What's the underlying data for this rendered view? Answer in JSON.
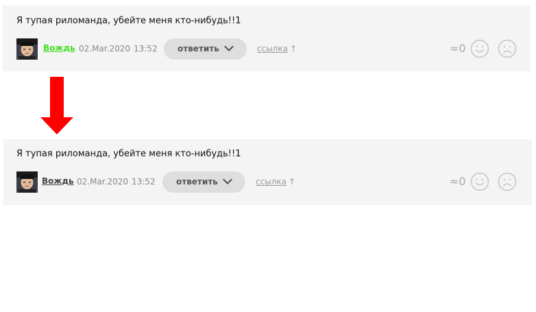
{
  "comments": [
    {
      "text": "Я тупая риломанда, убейте меня кто-нибудь!!1",
      "author": "Вождь",
      "author_color": "#44dd22",
      "date": "02.Mar.2020",
      "time": "13:52",
      "reply_label": "ответить",
      "link_label": "ссылка",
      "link_arrow": "↑",
      "score": "≈0",
      "icons": {
        "like": "smile-icon",
        "dislike": "frown-icon",
        "reply": "chevron-down-icon"
      }
    },
    {
      "text": "Я тупая риломанда, убейте меня кто-нибудь!!1",
      "author": "Вождь",
      "author_color": "#444444",
      "date": "02.Mar.2020",
      "time": "13:52",
      "reply_label": "ответить",
      "link_label": "ссылка",
      "link_arrow": "↑",
      "score": "≈0",
      "icons": {
        "like": "smile-icon",
        "dislike": "frown-icon",
        "reply": "chevron-down-icon"
      }
    }
  ],
  "annotation": {
    "arrow_color": "#ff0000",
    "arrow_icon": "arrow-down-icon"
  }
}
